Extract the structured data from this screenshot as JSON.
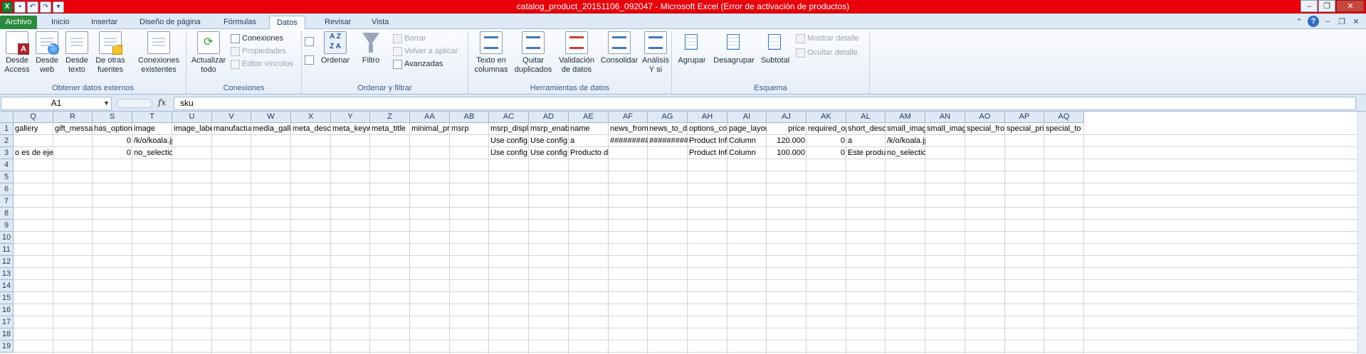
{
  "window": {
    "title": "catalog_product_20151106_092047  -  Microsoft Excel (Error de activación de productos)"
  },
  "tabs": [
    "Archivo",
    "Inicio",
    "Insertar",
    "Diseño de página",
    "Fórmulas",
    "Datos",
    "Revisar",
    "Vista"
  ],
  "ribbon": {
    "ext": {
      "label": "Obtener datos externos",
      "access": "Desde Access",
      "web": "Desde web",
      "text": "Desde texto",
      "other": "De otras fuentes",
      "existing": "Conexiones existentes"
    },
    "conn": {
      "label": "Conexiones",
      "refresh": "Actualizar todo",
      "connections": "Conexiones",
      "properties": "Propiedades",
      "edit_links": "Editar vínculos"
    },
    "sort": {
      "label": "Ordenar y filtrar",
      "sort": "Ordenar",
      "filter": "Filtro",
      "clear": "Borrar",
      "reapply": "Volver a aplicar",
      "advanced": "Avanzadas"
    },
    "tools": {
      "label": "Herramientas de datos",
      "text_to_cols": "Texto en columnas",
      "remove_dup": "Quitar duplicados",
      "validation": "Validación de datos",
      "consolidate": "Consolidar",
      "whatif": "Análisis Y si"
    },
    "outline": {
      "label": "Esquema",
      "group": "Agrupar",
      "ungroup": "Desagrupar",
      "subtotal": "Subtotal",
      "show_detail": "Mostrar detalle",
      "hide_detail": "Ocultar detalle"
    }
  },
  "formula_bar": {
    "name_box": "A1",
    "fx": "fx",
    "value": "sku"
  },
  "columns": [
    "Q",
    "R",
    "S",
    "T",
    "U",
    "V",
    "W",
    "X",
    "Y",
    "Z",
    "AA",
    "AB",
    "AC",
    "AD",
    "AE",
    "AF",
    "AG",
    "AH",
    "AI",
    "AJ",
    "AK",
    "AL",
    "AM",
    "AN",
    "AO",
    "AP",
    "AQ"
  ],
  "rows": [
    "1",
    "2",
    "3",
    "4",
    "5",
    "6",
    "7",
    "8",
    "9",
    "10",
    "11",
    "12",
    "13",
    "14",
    "15",
    "16",
    "17",
    "18",
    "19"
  ],
  "row1": [
    "gallery",
    "gift_messag",
    "has_options",
    "image",
    "image_labe",
    "manufacture",
    "media_galle",
    "meta_descri",
    "meta_keywo",
    "meta_title",
    "minimal_pri",
    "msrp",
    "msrp_displa",
    "msrp_enabl",
    "name",
    "news_from_",
    "news_to_da",
    "options_con",
    "page_layou",
    "price",
    "required_op",
    "short_descri",
    "small_imag",
    "small_imag",
    "special_fron",
    "special_pric",
    "special_to"
  ],
  "row2": {
    "S": "0",
    "T": "/k/o/koala.jpg",
    "AC": "Use config",
    "AD": "Use config",
    "AE": "a",
    "AF": "##########",
    "AG": "##########",
    "AH": "Product Info",
    "AI": "Column",
    "AJ": "120.000",
    "AK": "0",
    "AL": "a",
    "AM": "/k/o/koala.jpg"
  },
  "row3": {
    "Q": "o es de ejemplo",
    "S": "0",
    "T": "no_selection",
    "AC": "Use config",
    "AD": "Use config",
    "AE": "Producto de ejemplo",
    "AH": "Product Info",
    "AI": "Column",
    "AJ": "100.000",
    "AK": "0",
    "AL": "Este product",
    "AM": "no_selection"
  }
}
